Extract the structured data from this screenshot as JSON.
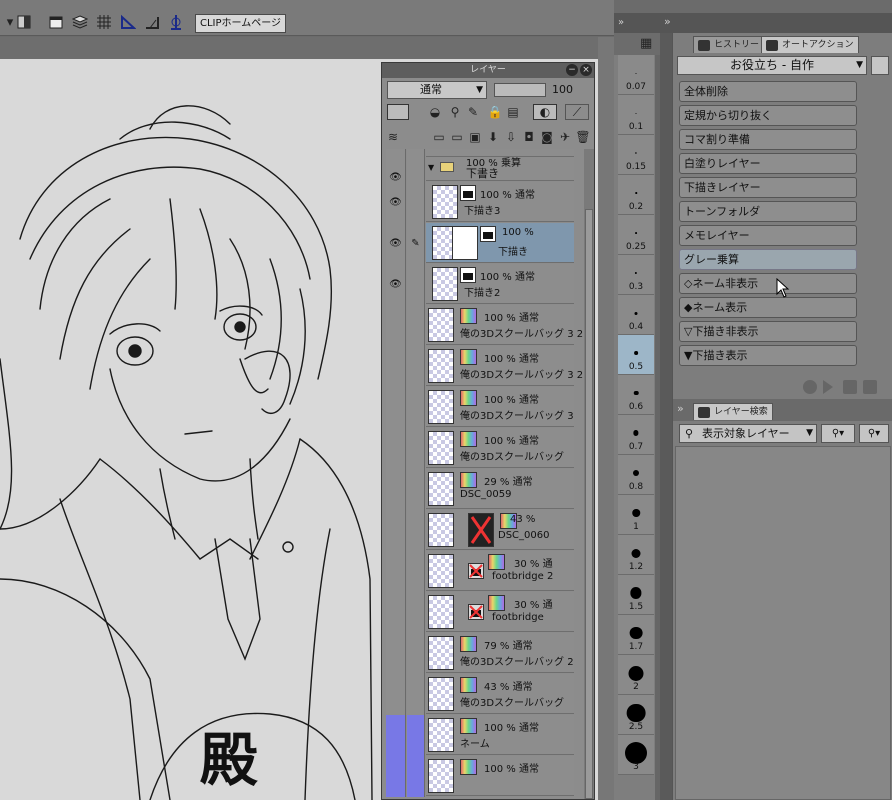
{
  "toolbar": {
    "clip_home_label": "CLIPホームページ"
  },
  "canvas": {
    "kanji": "殿"
  },
  "layer_panel": {
    "title": "レイヤー",
    "blend_mode": "通常",
    "opacity": "100",
    "folder_row": {
      "meta": "100 % 乗算",
      "name": "下書き"
    },
    "layers": [
      {
        "meta": "100 % 通常",
        "name": "下描き3"
      },
      {
        "meta": "100 %",
        "name": "下描き"
      },
      {
        "meta": "100 % 通常",
        "name": "下描き2"
      },
      {
        "meta": "100 % 通常",
        "name": "俺の3Dスクールバッグ 3 2"
      },
      {
        "meta": "100 % 通常",
        "name": "俺の3Dスクールバッグ 3 2"
      },
      {
        "meta": "100 % 通常",
        "name": "俺の3Dスクールバッグ 3"
      },
      {
        "meta": "100 % 通常",
        "name": "俺の3Dスクールバッグ"
      },
      {
        "meta": "29 % 通常",
        "name": "DSC_0059"
      },
      {
        "meta": "43 %",
        "name": "DSC_0060"
      },
      {
        "meta": "30 % 通",
        "name": "footbridge 2"
      },
      {
        "meta": "30 % 通",
        "name": "footbridge"
      },
      {
        "meta": "79 % 通常",
        "name": "俺の3Dスクールバッグ 2"
      },
      {
        "meta": "43 % 通常",
        "name": "俺の3Dスクールバッグ"
      },
      {
        "meta": "100 % 通常",
        "name": "ネーム"
      },
      {
        "meta": "100 % 通常",
        "name": ""
      }
    ]
  },
  "brush_sizes": [
    "0.07",
    "0.1",
    "0.15",
    "0.2",
    "0.25",
    "0.3",
    "0.4",
    "0.5",
    "0.6",
    "0.7",
    "0.8",
    "1",
    "1.2",
    "1.5",
    "1.7",
    "2",
    "2.5",
    "3"
  ],
  "right_panel": {
    "tabs": {
      "history": "ヒストリー",
      "auto_action": "オートアクション"
    },
    "auto_action_set": "お役立ち - 自作",
    "actions": [
      "全体削除",
      "定規から切り抜く",
      "コマ割り準備",
      "白塗りレイヤー",
      "下描きレイヤー",
      "トーンフォルダ",
      "メモレイヤー",
      "グレー乗算",
      "◇ネーム非表示",
      "◆ネーム表示",
      "▽下描き非表示",
      "▼下描き表示"
    ],
    "layer_search_tab": "レイヤー検索",
    "search_target": "表示対象レイヤー"
  },
  "colors": {
    "selection": "#7f97ad",
    "selected_brush": "#9db6c8",
    "ui_gray": "#7d7d7d"
  }
}
